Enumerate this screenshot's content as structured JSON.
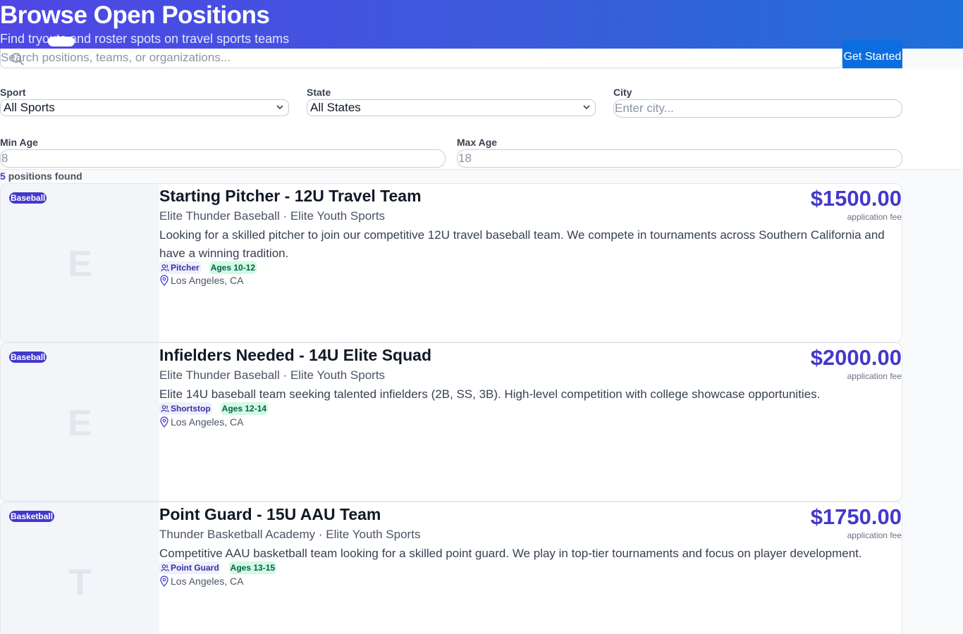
{
  "hero": {
    "title": "Browse Open Positions",
    "subtitle": "Find tryouts and roster spots on travel sports teams",
    "cta_label": "Get Started"
  },
  "search": {
    "placeholder": "Search positions, teams, or organizations...",
    "value": ""
  },
  "filters": {
    "sport": {
      "label": "Sport",
      "value": "All Sports"
    },
    "state": {
      "label": "State",
      "value": "All States"
    },
    "city": {
      "label": "City",
      "placeholder": "Enter city...",
      "value": ""
    },
    "min_age": {
      "label": "Min Age",
      "placeholder": "8",
      "value": ""
    },
    "max_age": {
      "label": "Max Age",
      "placeholder": "18",
      "value": ""
    }
  },
  "results": {
    "count": "5",
    "count_suffix": "positions found"
  },
  "positions": [
    {
      "sport": "Baseball",
      "initial": "E",
      "title": "Starting Pitcher - 12U Travel Team",
      "org": "Elite Thunder Baseball · Elite Youth Sports",
      "description": "Looking for a skilled pitcher to join our competitive 12U travel baseball team. We compete in tournaments across Southern California and have a winning tradition.",
      "position_tag": "Pitcher",
      "age_tag": "Ages 10-12",
      "location": "Los Angeles, CA",
      "fee": "$1500.00",
      "fee_label": "application fee"
    },
    {
      "sport": "Baseball",
      "initial": "E",
      "title": "Infielders Needed - 14U Elite Squad",
      "org": "Elite Thunder Baseball · Elite Youth Sports",
      "description": "Elite 14U baseball team seeking talented infielders (2B, SS, 3B). High-level competition with college showcase opportunities.",
      "position_tag": "Shortstop",
      "age_tag": "Ages 12-14",
      "location": "Los Angeles, CA",
      "fee": "$2000.00",
      "fee_label": "application fee"
    },
    {
      "sport": "Basketball",
      "initial": "T",
      "title": "Point Guard - 15U AAU Team",
      "org": "Thunder Basketball Academy · Elite Youth Sports",
      "description": "Competitive AAU basketball team looking for a skilled point guard. We play in top-tier tournaments and focus on player development.",
      "position_tag": "Point Guard",
      "age_tag": "Ages 13-15",
      "location": "Los Angeles, CA",
      "fee": "$1750.00",
      "fee_label": "application fee"
    }
  ],
  "colors": {
    "accent": "#4338ca",
    "cta": "#0b6ee0",
    "hero_start": "#4f46e5",
    "hero_end": "#1e6fd9",
    "age_tag_bg": "#d1fae5"
  }
}
